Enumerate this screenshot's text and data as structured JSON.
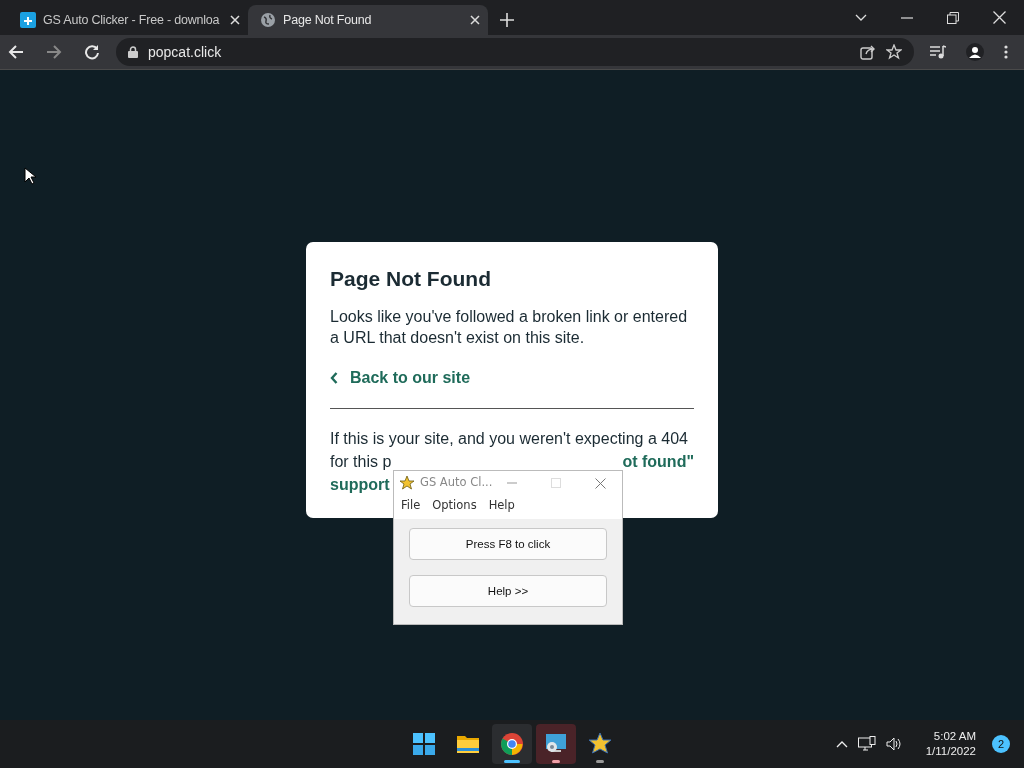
{
  "browser": {
    "tabs": [
      {
        "title": "GS Auto Clicker - Free - downloa",
        "kind": "app",
        "selected": false
      },
      {
        "title": "Page Not Found",
        "kind": "globe",
        "selected": true
      }
    ],
    "address": "popcat.click"
  },
  "page": {
    "card": {
      "title": "Page Not Found",
      "text": "Looks like you've followed a broken link or entered a URL that doesn't exist on this site.",
      "back_link": "Back to our site",
      "note_line_1": "If this is your site, and you weren't expecting a 404",
      "note_line_2_start": "for this p",
      "note_line_2_link_end": "ot found\"",
      "note_line_3_link": "support"
    }
  },
  "overlay_window": {
    "title": "GS Auto Cl...",
    "menu": [
      "File",
      "Options",
      "Help"
    ],
    "buttons": [
      "Press F8 to click",
      "Help >>"
    ]
  },
  "taskbar": {
    "apps": [
      {
        "kind": "start",
        "running": false,
        "active": false,
        "attention": false
      },
      {
        "kind": "folder",
        "running": false,
        "active": false,
        "attention": false
      },
      {
        "kind": "chrome",
        "running": true,
        "active": true,
        "attention": false
      },
      {
        "kind": "remote",
        "running": true,
        "active": false,
        "attention": true
      },
      {
        "kind": "star",
        "running": true,
        "active": false,
        "attention": false
      }
    ],
    "time": "5:02 AM",
    "date": "1/11/2022",
    "notifications": "2"
  }
}
